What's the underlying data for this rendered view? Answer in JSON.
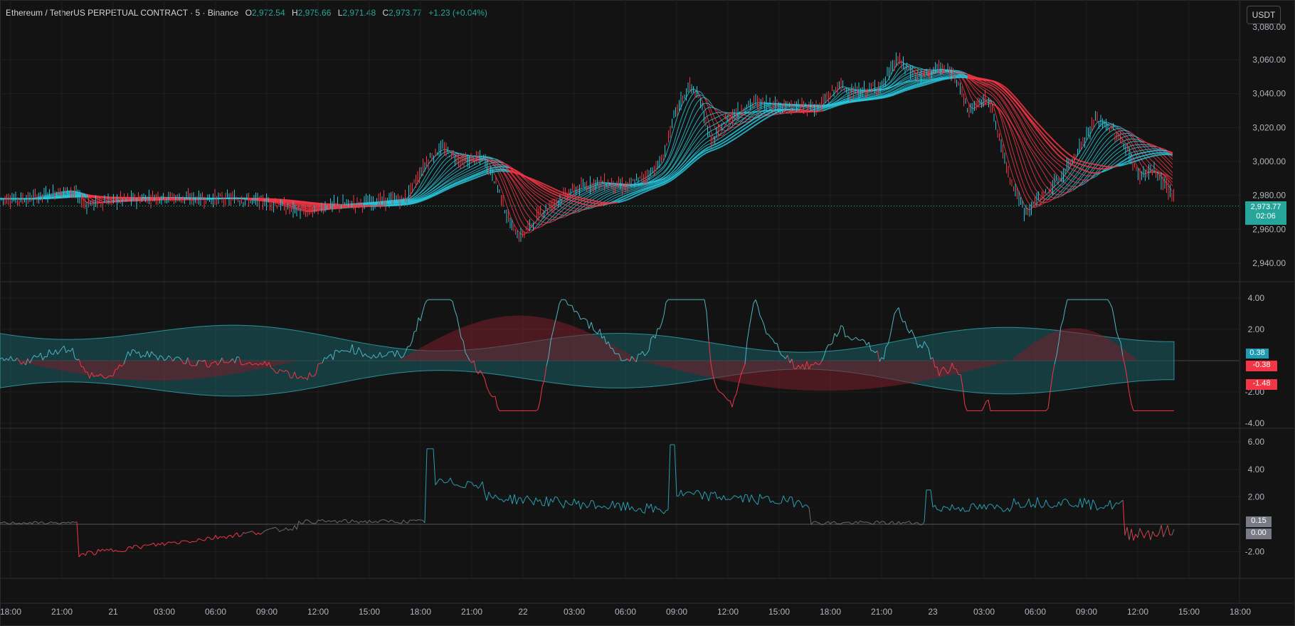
{
  "header": {
    "symbol": "Ethereum / TetherUS PERPETUAL CONTRACT · 5 · Binance",
    "o_label": "O",
    "o_value": "2,972.54",
    "h_label": "H",
    "h_value": "2,975.66",
    "l_label": "L",
    "l_value": "2,971.48",
    "c_label": "C",
    "c_value": "2,973.77",
    "change": "+1.23 (+0.04%)"
  },
  "currency_button": "USDT",
  "price_axis": [
    "3,060.00",
    "3,040.00",
    "3,020.00",
    "3,000.00",
    "2,980.00",
    "2,960.00",
    "2,940.00"
  ],
  "price_axis_top_partial": "3,080.00",
  "last_price": {
    "value": "2,973.77",
    "countdown": "02:06"
  },
  "osc1_axis": [
    "4.00",
    "2.00",
    "-2.00",
    "-4.00"
  ],
  "osc1_tags": {
    "upper": "0.38",
    "mid": "-0.38",
    "lower": "-1.48"
  },
  "osc2_axis": [
    "6.00",
    "4.00",
    "2.00",
    "-2.00"
  ],
  "osc2_tags": {
    "a": "0.15",
    "b": "0.00"
  },
  "time_axis": [
    "18:00",
    "21:00",
    "21",
    "03:00",
    "06:00",
    "09:00",
    "12:00",
    "15:00",
    "18:00",
    "21:00",
    "22",
    "03:00",
    "06:00",
    "09:00",
    "12:00",
    "15:00",
    "18:00",
    "21:00",
    "23",
    "03:00",
    "06:00",
    "09:00",
    "12:00",
    "15:00",
    "18:00"
  ],
  "colors": {
    "bull": "#26c6da",
    "bear": "#f23645",
    "teal": "#1c8b8b",
    "grid": "#1f1f1f",
    "bg": "#131313"
  }
}
